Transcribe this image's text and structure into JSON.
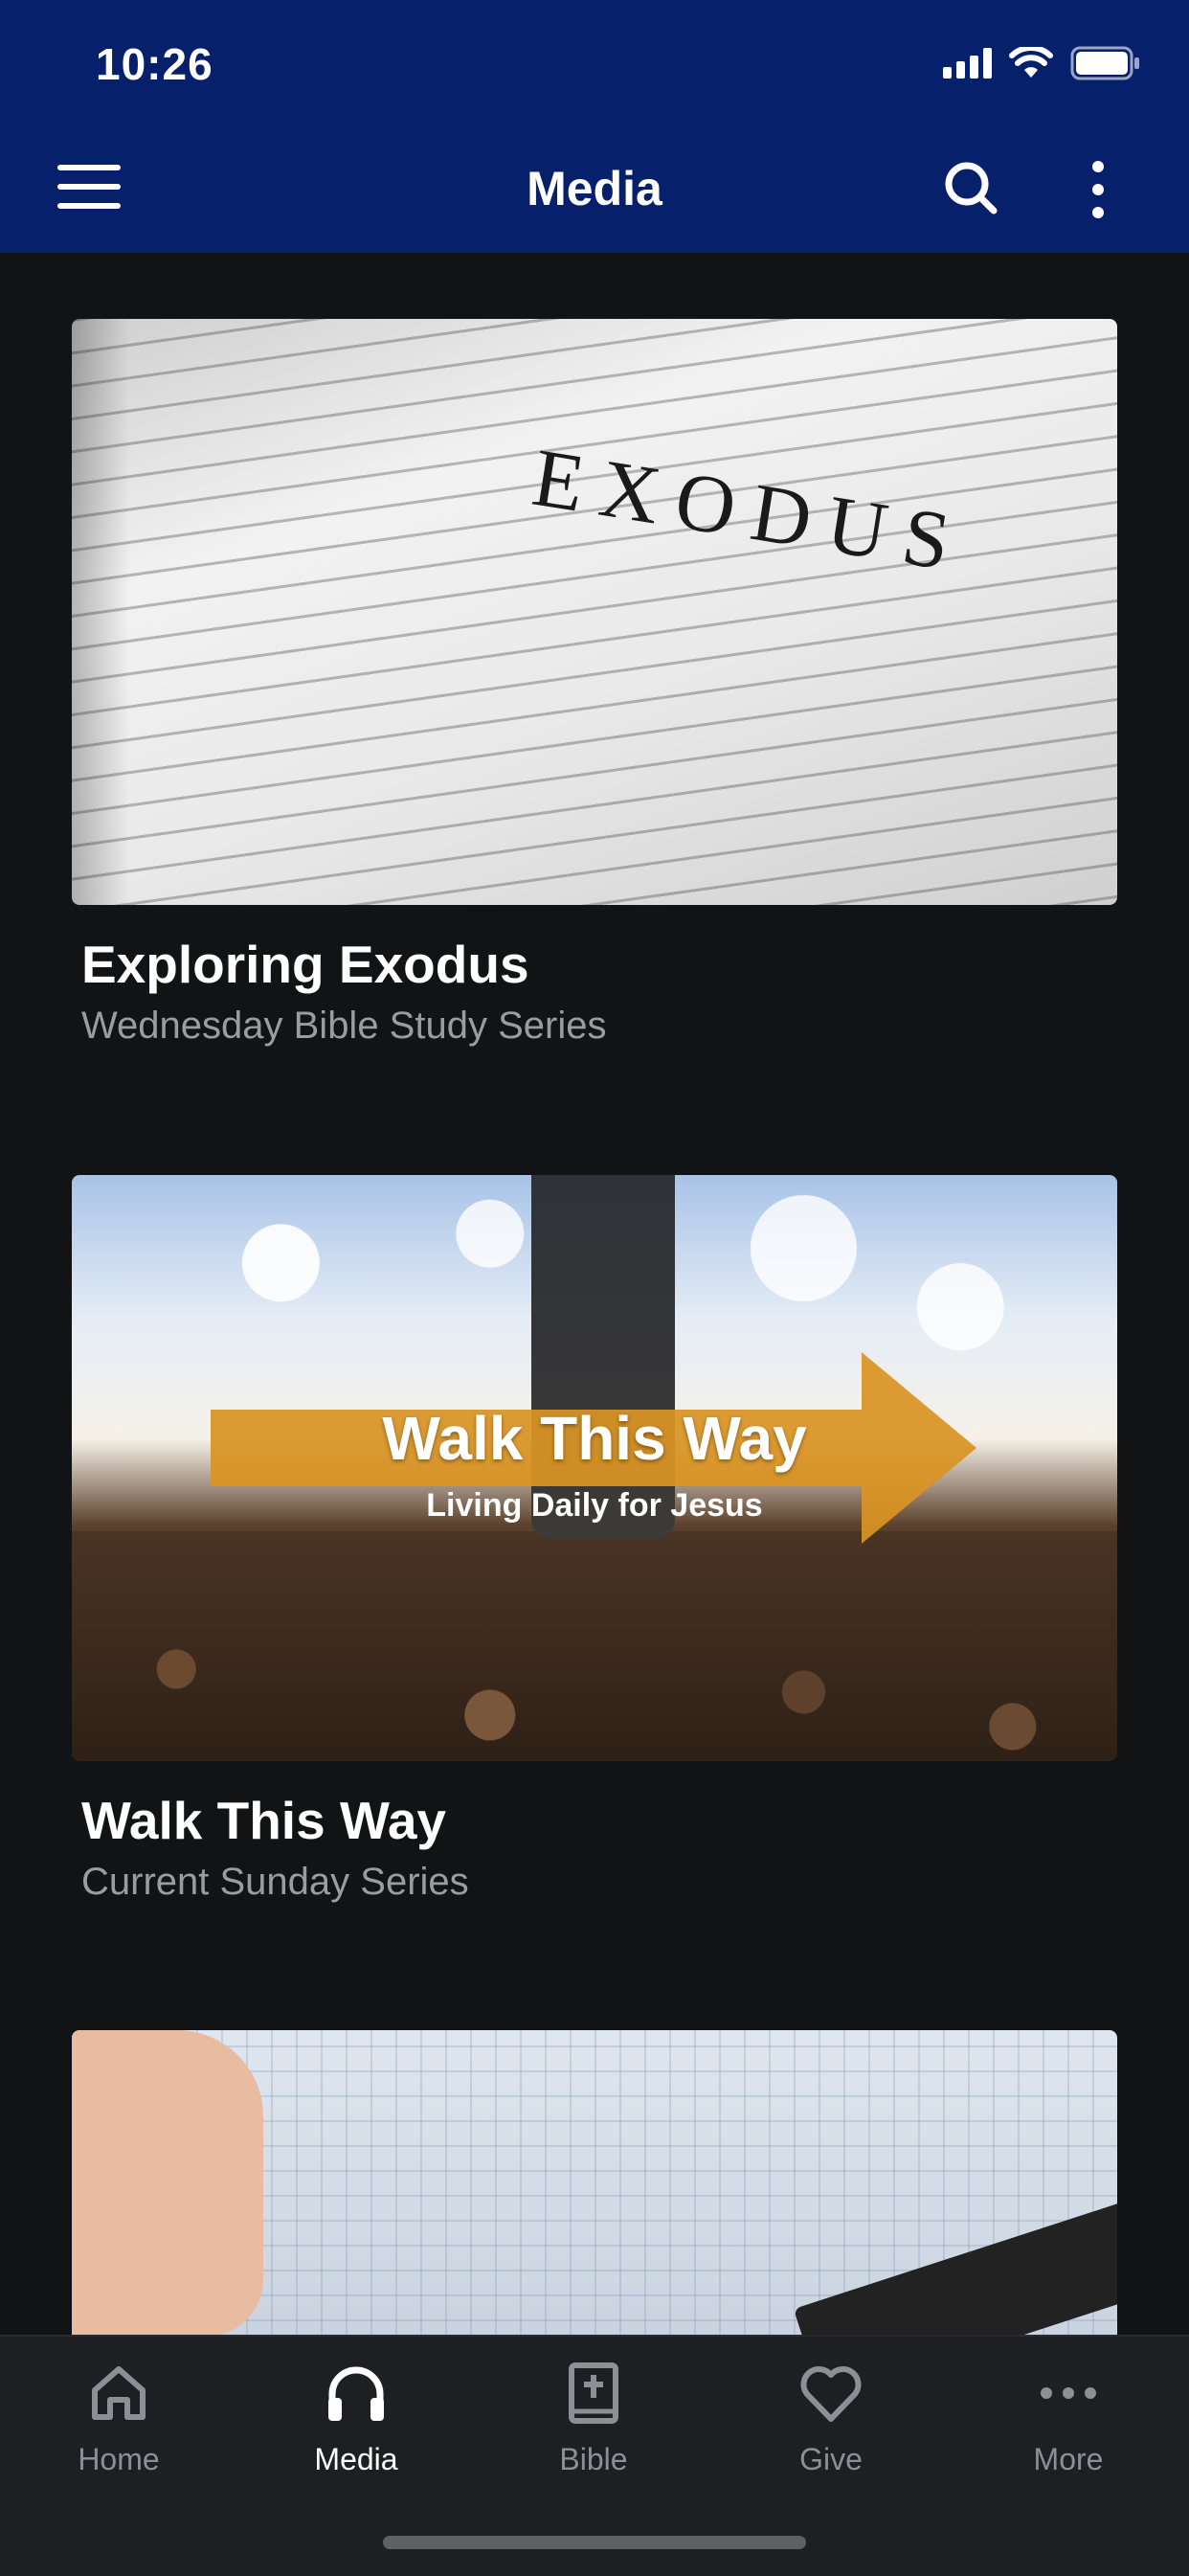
{
  "status_bar": {
    "time": "10:26"
  },
  "header": {
    "title": "Media"
  },
  "cards": [
    {
      "title": "Exploring Exodus",
      "subtitle": "Wednesday Bible Study Series",
      "image_text": "EXODUS"
    },
    {
      "title": "Walk This Way",
      "subtitle": "Current Sunday Series",
      "banner_title": "Walk This Way",
      "banner_subtitle": "Living Daily for Jesus"
    },
    {
      "title": "",
      "subtitle": ""
    }
  ],
  "tabs": [
    {
      "label": "Home",
      "icon": "home-icon"
    },
    {
      "label": "Media",
      "icon": "headphones-icon",
      "active": true
    },
    {
      "label": "Bible",
      "icon": "bible-icon"
    },
    {
      "label": "Give",
      "icon": "heart-icon"
    },
    {
      "label": "More",
      "icon": "more-dots-icon"
    }
  ],
  "colors": {
    "header_bg": "#06206b",
    "page_bg": "#121315",
    "tab_bg": "#1e1f22",
    "banner_orange": "#d99323"
  }
}
